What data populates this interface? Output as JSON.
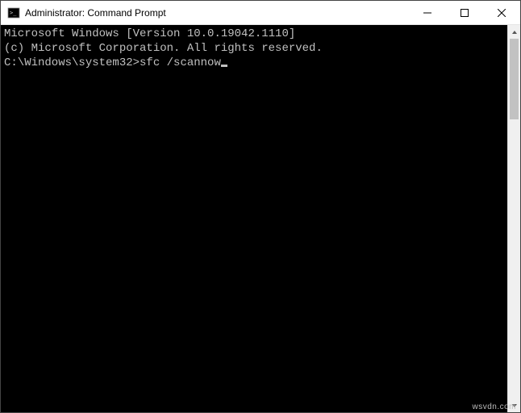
{
  "window": {
    "title": "Administrator: Command Prompt"
  },
  "terminal": {
    "line1": "Microsoft Windows [Version 10.0.19042.1110]",
    "line2": "(c) Microsoft Corporation. All rights reserved.",
    "blank1": "",
    "prompt_prefix": "C:\\Windows\\system32>",
    "command": "sfc /scannow"
  },
  "watermark": "wsvdn.com"
}
